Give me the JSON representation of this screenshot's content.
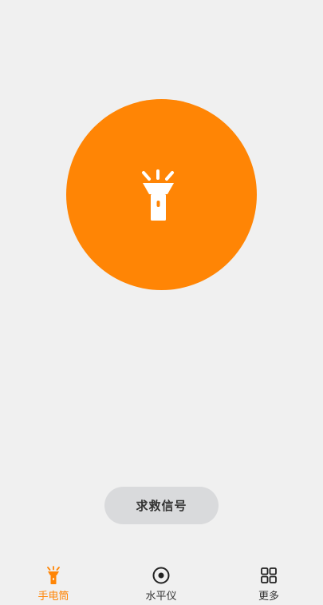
{
  "colors": {
    "accent": "#ff8505",
    "background": "#f0f0f0",
    "sos_button_bg": "#d9dadc"
  },
  "main": {
    "torch_icon": "flashlight-icon",
    "sos_label": "求救信号"
  },
  "tabbar": {
    "tabs": [
      {
        "label": "手电筒",
        "icon": "flashlight-icon",
        "active": true
      },
      {
        "label": "水平仪",
        "icon": "level-icon",
        "active": false
      },
      {
        "label": "更多",
        "icon": "grid-icon",
        "active": false
      }
    ]
  }
}
